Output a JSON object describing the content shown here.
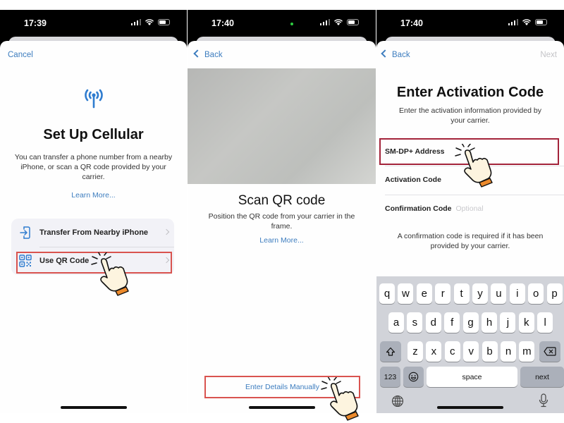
{
  "screens": [
    {
      "status": {
        "time": "17:39"
      },
      "nav": {
        "left": "Cancel"
      },
      "icon": "antenna-icon",
      "title": "Set Up Cellular",
      "subtitle": "You can transfer a phone number from a nearby iPhone, or scan a QR code provided by your carrier.",
      "learn_more": "Learn More...",
      "options": [
        {
          "label": "Transfer From Nearby iPhone",
          "icon": "transfer-icon"
        },
        {
          "label": "Use QR Code",
          "icon": "qr-code-icon",
          "highlighted": true
        }
      ]
    },
    {
      "status": {
        "time": "17:40"
      },
      "nav": {
        "left": "Back"
      },
      "title": "Scan QR code",
      "subtitle": "Position the QR code from your carrier in the frame.",
      "learn_more": "Learn More...",
      "manual_button": "Enter Details Manually"
    },
    {
      "status": {
        "time": "17:40"
      },
      "nav": {
        "left": "Back",
        "right": "Next"
      },
      "title": "Enter Activation Code",
      "subtitle": "Enter the activation information provided by your carrier.",
      "fields": [
        {
          "label": "SM-DP+ Address",
          "highlighted": true
        },
        {
          "label": "Activation Code"
        },
        {
          "label": "Confirmation Code",
          "placeholder": "Optional"
        }
      ],
      "note": "A confirmation code is required if it has been provided by your carrier.",
      "keyboard": {
        "row1": [
          "q",
          "w",
          "e",
          "r",
          "t",
          "y",
          "u",
          "i",
          "o",
          "p"
        ],
        "row2": [
          "a",
          "s",
          "d",
          "f",
          "g",
          "h",
          "j",
          "k",
          "l"
        ],
        "row3": [
          "z",
          "x",
          "c",
          "v",
          "b",
          "n",
          "m"
        ],
        "numbers": "123",
        "space": "space",
        "next": "next"
      }
    }
  ],
  "colors": {
    "accent": "#3d7dbf",
    "highlight": "#d9534f",
    "highlight_dark": "#a3233a"
  }
}
